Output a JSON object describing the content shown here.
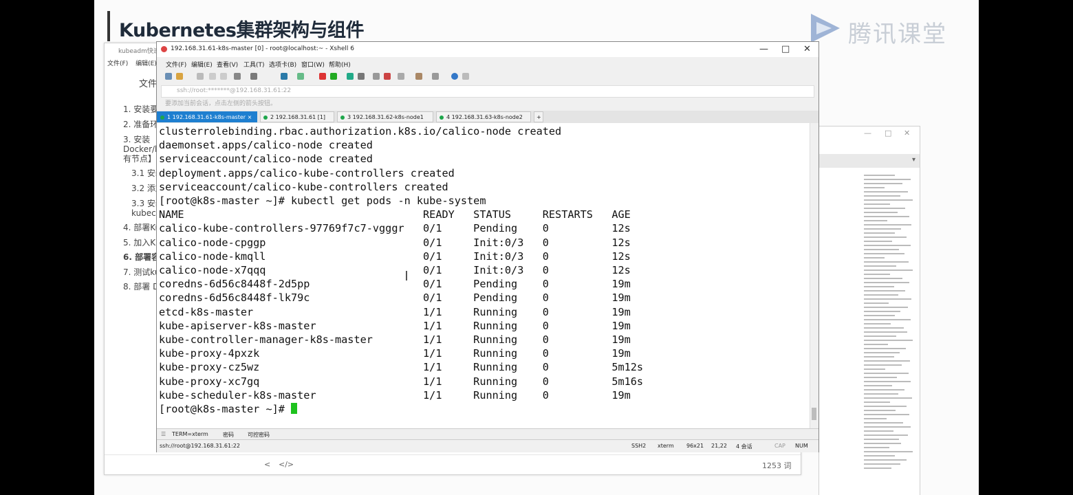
{
  "slide": {
    "title": "Kubernetes集群架构与组件",
    "logo_text": "腾讯课堂"
  },
  "doc": {
    "title": "kubeadm快速",
    "menu": [
      "文件(F)",
      "编辑(E)"
    ],
    "heading": "文件",
    "toc": [
      "1. 安装要",
      "2. 准备环",
      "3. 安装",
      "Docker/k",
      "有节点】",
      "3.1 安装",
      "3.2 添加",
      "3.3 安装",
      "kubec",
      "4. 部署Ku",
      "5. 加入K",
      "6. 部署容",
      "7. 测试ku",
      "8. 部署 D"
    ],
    "footer": {
      "nav": "<",
      "code": "</>",
      "count": "1253 词"
    }
  },
  "xshell": {
    "title": "192.168.31.61-k8s-master [0] - root@localhost:~ - Xshell 6",
    "window_controls": {
      "minimize": "×",
      "maximize": "□",
      "close": "✕"
    },
    "menu": [
      "文件(F)",
      "编辑(E)",
      "查看(V)",
      "工具(T)",
      "选项卡(B)",
      "窗口(W)",
      "帮助(H)"
    ],
    "address": "ssh://root:*******@192.168.31.61:22",
    "hint": "要添加当前会话，点击左侧的箭头按钮。",
    "tabs": [
      "1 192.168.31.61-k8s-master ×",
      "2 192.168.31.61 [1]",
      "3 192.168.31.62-k8s-node1",
      "4 192.168.31.63-k8s-node2"
    ],
    "tab_add": "+",
    "terminal_lines": [
      "clusterrolebinding.rbac.authorization.k8s.io/calico-node created",
      "daemonset.apps/calico-node created",
      "serviceaccount/calico-node created",
      "deployment.apps/calico-kube-controllers created",
      "serviceaccount/calico-kube-controllers created",
      "[root@k8s-master ~]# kubectl get pods -n kube-system"
    ],
    "pods_header": [
      "NAME",
      "READY",
      "STATUS",
      "RESTARTS",
      "AGE"
    ],
    "pods": [
      [
        "calico-kube-controllers-97769f7c7-vgggr",
        "0/1",
        "Pending",
        "0",
        "12s"
      ],
      [
        "calico-node-cpggp",
        "0/1",
        "Init:0/3",
        "0",
        "12s"
      ],
      [
        "calico-node-kmqll",
        "0/1",
        "Init:0/3",
        "0",
        "12s"
      ],
      [
        "calico-node-x7qqq",
        "0/1",
        "Init:0/3",
        "0",
        "12s"
      ],
      [
        "coredns-6d56c8448f-2d5pp",
        "0/1",
        "Pending",
        "0",
        "19m"
      ],
      [
        "coredns-6d56c8448f-lk79c",
        "0/1",
        "Pending",
        "0",
        "19m"
      ],
      [
        "etcd-k8s-master",
        "1/1",
        "Running",
        "0",
        "19m"
      ],
      [
        "kube-apiserver-k8s-master",
        "1/1",
        "Running",
        "0",
        "19m"
      ],
      [
        "kube-controller-manager-k8s-master",
        "1/1",
        "Running",
        "0",
        "19m"
      ],
      [
        "kube-proxy-4pxzk",
        "1/1",
        "Running",
        "0",
        "19m"
      ],
      [
        "kube-proxy-cz5wz",
        "1/1",
        "Running",
        "0",
        "5m12s"
      ],
      [
        "kube-proxy-xc7gq",
        "1/1",
        "Running",
        "0",
        "5m16s"
      ],
      [
        "kube-scheduler-k8s-master",
        "1/1",
        "Running",
        "0",
        "19m"
      ]
    ],
    "prompt": "[root@k8s-master ~]# ",
    "compose": [
      "TERM=xterm",
      "密码",
      "可控密码"
    ],
    "status": {
      "conn": "ssh://root@192.168.31.61:22",
      "proto": "SSH2",
      "term": "xterm",
      "size": "96x21",
      "pos": "21,22",
      "sessions": "4 会话",
      "cap": "CAP",
      "num": "NUM"
    }
  }
}
